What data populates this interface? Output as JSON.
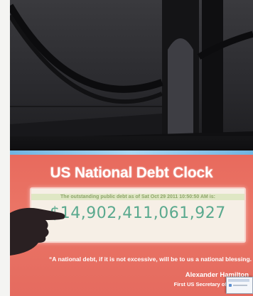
{
  "clock": {
    "title": "US National Debt Clock",
    "subtitle": "The outstanding public debt as of Sat Oct 29 2011 10:50:50 AM is:",
    "amount": "$14,902,411,061,927",
    "quote": "“A national debt, if it is not excessive, will be to us a national blessing.",
    "author": "Alexander Hamilton",
    "author_role": "First US Secretary of th"
  },
  "colors": {
    "panel": "#e86a5d",
    "amount": "#5aa98e",
    "screen_edge": "#a9d7f2"
  },
  "icons": {
    "popup": "notification-popup-icon"
  }
}
